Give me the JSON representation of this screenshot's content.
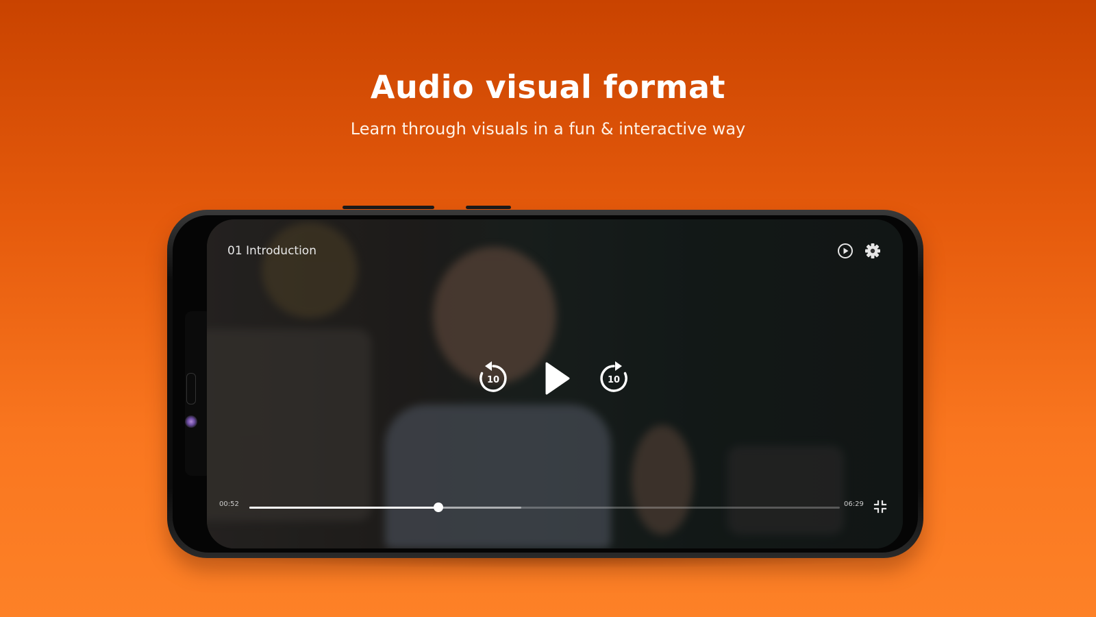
{
  "promo": {
    "title": "Audio visual format",
    "subtitle": "Learn through visuals in a fun & interactive way"
  },
  "player": {
    "video_title": "01 Introduction",
    "current_time": "00:52",
    "total_time": "06:29",
    "progress_fraction": 0.32,
    "buffered_fraction": 0.46,
    "rewind_seconds": "10",
    "forward_seconds": "10",
    "icons": {
      "autoplay": "play-circle-icon",
      "settings": "gear-icon",
      "rewind": "replay-10-icon",
      "play": "play-icon",
      "forward": "forward-10-icon",
      "fullscreen": "exit-fullscreen-icon"
    }
  },
  "colors": {
    "background_top": "#c94300",
    "background_bottom": "#fd8127",
    "text": "#ffffff"
  }
}
